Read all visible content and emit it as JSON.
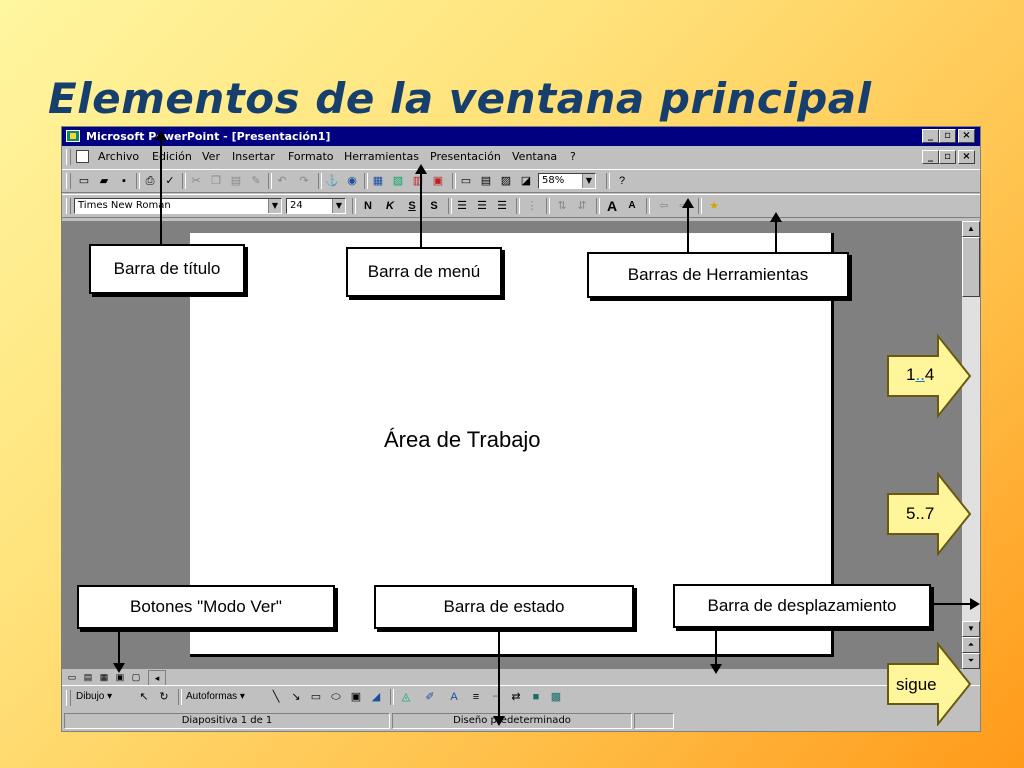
{
  "slide": {
    "title": "Elementos de la ventana principal"
  },
  "window": {
    "title": "Microsoft PowerPoint - [Presentación1]",
    "menu": [
      "Archivo",
      "Edición",
      "Ver",
      "Insertar",
      "Formato",
      "Herramientas",
      "Presentación",
      "Ventana",
      "?"
    ],
    "standard_toolbar": {
      "zoom": "58%"
    },
    "format_toolbar": {
      "font": "Times New Roman",
      "size": "24",
      "bold": "N",
      "italic": "K",
      "underline": "S",
      "shadow": "S"
    },
    "drawing_toolbar": {
      "draw_label": "Dibujo",
      "autoshapes_label": "Autoformas"
    },
    "status_bar": {
      "slide_info": "Diapositiva 1 de 1",
      "design": "Diseño predeterminado"
    }
  },
  "annotations": {
    "title_bar": "Barra de título",
    "menu_bar": "Barra de menú",
    "toolbars": "Barras de Herramientas",
    "work_area": "Área de Trabajo",
    "view_buttons": "Botones \"Modo Ver\"",
    "status_bar": "Barra de estado",
    "scroll_bar": "Barra de desplazamiento"
  },
  "navigation": {
    "link1": {
      "prefix": "1",
      "link": "..",
      "suffix": "4"
    },
    "link2": "5..7",
    "next": "sigue"
  },
  "colors": {
    "title_text": "#163f6e",
    "window_title_bg": "#000080",
    "link": "#1a6fd6"
  }
}
